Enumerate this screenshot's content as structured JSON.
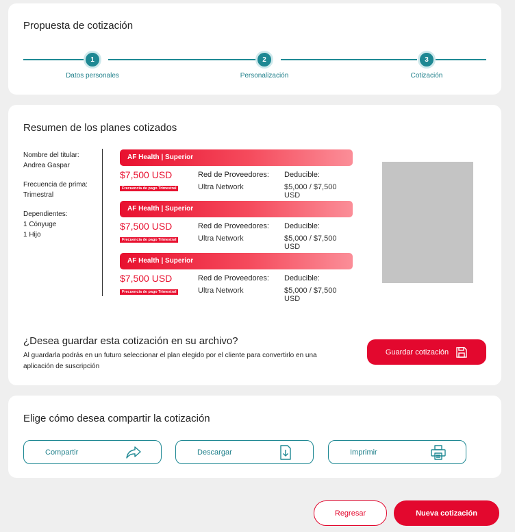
{
  "header": {
    "title": "Propuesta de cotización",
    "steps": [
      {
        "number": "1",
        "label": "Datos personales"
      },
      {
        "number": "2",
        "label": "Personalización"
      },
      {
        "number": "3",
        "label": "Cotización"
      }
    ]
  },
  "summary": {
    "title": "Resumen de los planes cotizados",
    "holder_label": "Nombre del titular:",
    "holder_value": "Andrea Gaspar",
    "frequency_label": "Frecuencia de prima:",
    "frequency_value": "Trimestral",
    "dependents_label": "Dependientes:",
    "dependents": [
      "1 Cónyuge",
      "1 Hijo"
    ],
    "plans": [
      {
        "name": "AF Health | Superior",
        "price": "$7,500 USD",
        "freq_badge": "Frecuencia de pago Trimestral",
        "network_label": "Red de Proveedores:",
        "network_value": "Ultra Network",
        "deductible_label": "Deducible:",
        "deductible_value": "$5,000 / $7,500 USD"
      },
      {
        "name": "AF Health | Superior",
        "price": "$7,500 USD",
        "freq_badge": "Frecuencia de pago Trimestral",
        "network_label": "Red de Proveedores:",
        "network_value": "Ultra Network",
        "deductible_label": "Deducible:",
        "deductible_value": "$5,000 / $7,500 USD"
      },
      {
        "name": "AF Health | Superior",
        "price": "$7,500 USD",
        "freq_badge": "Frecuencia de pago Trimestral",
        "network_label": "Red de Proveedores:",
        "network_value": "Ultra Network",
        "deductible_label": "Deducible:",
        "deductible_value": "$5,000 / $7,500 USD"
      }
    ]
  },
  "save": {
    "title": "¿Desea guardar esta cotización en su archivo?",
    "text": "Al guardarla podrás en un futuro seleccionar el plan elegido por el cliente para convertirlo en una aplicación de suscripción",
    "button": "Guardar cotización",
    "icon": "save-icon"
  },
  "share": {
    "title": "Elige cómo desea compartir la cotización",
    "buttons": [
      {
        "label": "Compartir",
        "icon": "share-icon"
      },
      {
        "label": "Descargar",
        "icon": "download-icon"
      },
      {
        "label": "Imprimir",
        "icon": "print-icon"
      }
    ]
  },
  "footer": {
    "back": "Regresar",
    "new": "Nueva cotización"
  },
  "colors": {
    "accent_red": "#e3082e",
    "teal": "#1e8893",
    "background": "#efefef"
  }
}
